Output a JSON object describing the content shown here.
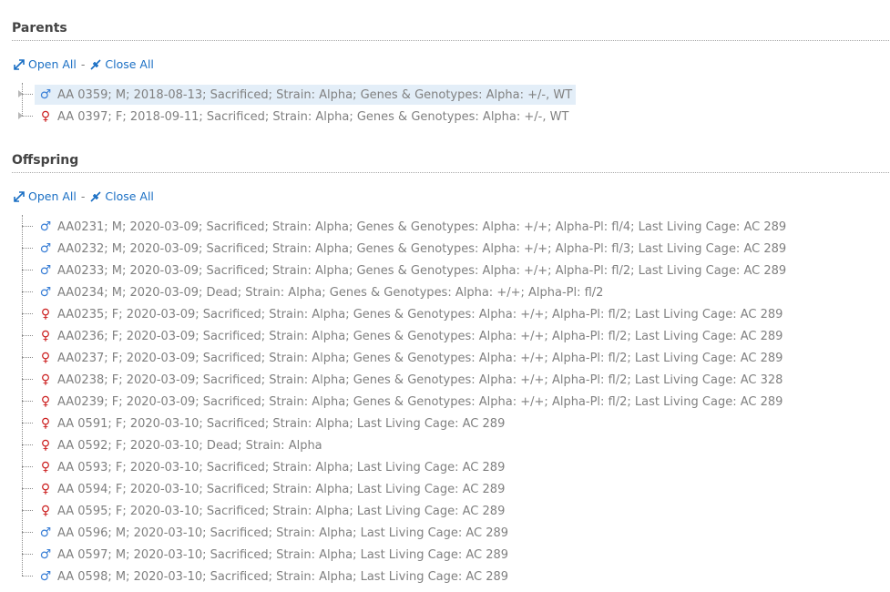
{
  "parents": {
    "title": "Parents",
    "open_all": "Open All",
    "separator": "-",
    "close_all": "Close All",
    "items": [
      {
        "gender": "male",
        "symbol": "♂",
        "text": "AA 0359; M; 2018-08-13; Sacrificed; Strain: Alpha; Genes & Genotypes: Alpha: +/-, WT",
        "selected": true
      },
      {
        "gender": "female",
        "symbol": "♀",
        "text": "AA 0397; F; 2018-09-11; Sacrificed; Strain: Alpha; Genes & Genotypes: Alpha: +/-, WT",
        "selected": false
      }
    ]
  },
  "offspring": {
    "title": "Offspring",
    "open_all": "Open All",
    "separator": "-",
    "close_all": "Close All",
    "items": [
      {
        "gender": "male",
        "symbol": "♂",
        "text": "AA0231; M; 2020-03-09; Sacrificed; Strain: Alpha; Genes & Genotypes: Alpha: +/+; Alpha-Pl: fl/4; Last Living Cage: AC 289"
      },
      {
        "gender": "male",
        "symbol": "♂",
        "text": "AA0232; M; 2020-03-09; Sacrificed; Strain: Alpha; Genes & Genotypes: Alpha: +/+; Alpha-Pl: fl/3; Last Living Cage: AC 289"
      },
      {
        "gender": "male",
        "symbol": "♂",
        "text": "AA0233; M; 2020-03-09; Sacrificed; Strain: Alpha; Genes & Genotypes: Alpha: +/+; Alpha-Pl: fl/2; Last Living Cage: AC 289"
      },
      {
        "gender": "male",
        "symbol": "♂",
        "text": "AA0234; M; 2020-03-09; Dead; Strain: Alpha; Genes & Genotypes: Alpha: +/+; Alpha-Pl: fl/2"
      },
      {
        "gender": "female",
        "symbol": "♀",
        "text": "AA0235; F; 2020-03-09; Sacrificed; Strain: Alpha; Genes & Genotypes: Alpha: +/+; Alpha-Pl: fl/2; Last Living Cage: AC 289"
      },
      {
        "gender": "female",
        "symbol": "♀",
        "text": "AA0236; F; 2020-03-09; Sacrificed; Strain: Alpha; Genes & Genotypes: Alpha: +/+; Alpha-Pl: fl/2; Last Living Cage: AC 289"
      },
      {
        "gender": "female",
        "symbol": "♀",
        "text": "AA0237; F; 2020-03-09; Sacrificed; Strain: Alpha; Genes & Genotypes: Alpha: +/+; Alpha-Pl: fl/2; Last Living Cage: AC 289"
      },
      {
        "gender": "female",
        "symbol": "♀",
        "text": "AA0238; F; 2020-03-09; Sacrificed; Strain: Alpha; Genes & Genotypes: Alpha: +/+; Alpha-Pl: fl/2; Last Living Cage: AC 328"
      },
      {
        "gender": "female",
        "symbol": "♀",
        "text": "AA0239; F; 2020-03-09; Sacrificed; Strain: Alpha; Genes & Genotypes: Alpha: +/+; Alpha-Pl: fl/2; Last Living Cage: AC 289"
      },
      {
        "gender": "female",
        "symbol": "♀",
        "text": "AA 0591; F; 2020-03-10; Sacrificed; Strain: Alpha; Last Living Cage: AC 289"
      },
      {
        "gender": "female",
        "symbol": "♀",
        "text": "AA 0592; F; 2020-03-10; Dead; Strain: Alpha"
      },
      {
        "gender": "female",
        "symbol": "♀",
        "text": "AA 0593; F; 2020-03-10; Sacrificed; Strain: Alpha; Last Living Cage: AC 289"
      },
      {
        "gender": "female",
        "symbol": "♀",
        "text": "AA 0594; F; 2020-03-10; Sacrificed; Strain: Alpha; Last Living Cage: AC 289"
      },
      {
        "gender": "female",
        "symbol": "♀",
        "text": "AA 0595; F; 2020-03-10; Sacrificed; Strain: Alpha; Last Living Cage: AC 289"
      },
      {
        "gender": "male",
        "symbol": "♂",
        "text": "AA 0596; M; 2020-03-10; Sacrificed; Strain: Alpha; Last Living Cage: AC 289"
      },
      {
        "gender": "male",
        "symbol": "♂",
        "text": "AA 0597; M; 2020-03-10; Sacrificed; Strain: Alpha; Last Living Cage: AC 289"
      },
      {
        "gender": "male",
        "symbol": "♂",
        "text": "AA 0598; M; 2020-03-10; Sacrificed; Strain: Alpha; Last Living Cage: AC 289"
      }
    ]
  },
  "icons": {
    "open_all": "expand-arrows-icon",
    "close_all": "collapse-arrows-icon",
    "male": "male-symbol-icon",
    "female": "female-symbol-icon"
  },
  "colors": {
    "link": "#1a6fc4",
    "male": "#3a7fd6",
    "female": "#cc2020",
    "selected_bg": "#e3eef8",
    "text": "#808080",
    "heading": "#444444"
  }
}
